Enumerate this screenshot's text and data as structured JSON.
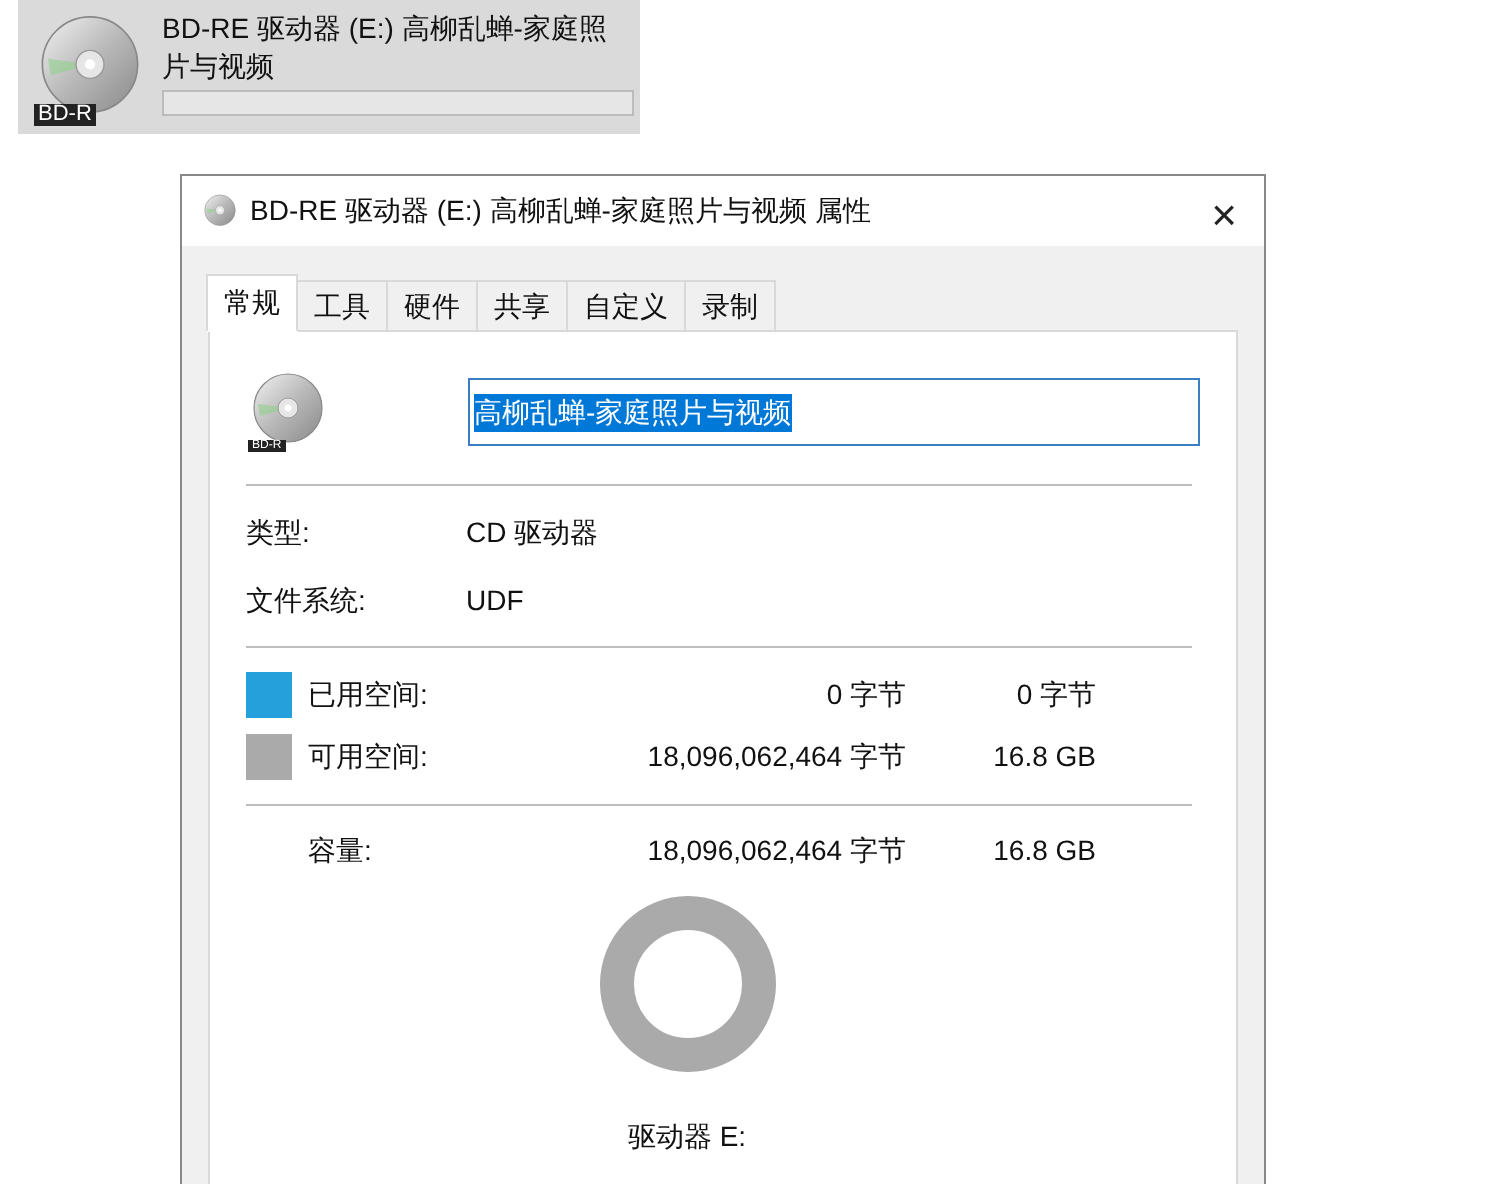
{
  "drive_tile": {
    "name": "BD-RE 驱动器 (E:) 高柳乱蝉-家庭照片与视频",
    "icon_label": "BD-R",
    "level": 0
  },
  "dialog": {
    "title": "BD-RE 驱动器 (E:) 高柳乱蝉-家庭照片与视频 属性",
    "close": "×"
  },
  "tabs": [
    {
      "label": "常规",
      "selected": true
    },
    {
      "label": "工具",
      "selected": false
    },
    {
      "label": "硬件",
      "selected": false
    },
    {
      "label": "共享",
      "selected": false
    },
    {
      "label": "自定义",
      "selected": false
    },
    {
      "label": "录制",
      "selected": false
    }
  ],
  "general": {
    "icon_label": "BD-R",
    "name_value": "高柳乱蝉-家庭照片与视频",
    "info": [
      {
        "label": "类型:",
        "value": "CD 驱动器"
      },
      {
        "label": "文件系统:",
        "value": "UDF"
      }
    ],
    "space": [
      {
        "label": "已用空间:",
        "bytes": "0 字节",
        "size": "0 字节",
        "color": "#26a0da"
      },
      {
        "label": "可用空间:",
        "bytes": "18,096,062,464 字节",
        "size": "16.8 GB",
        "color": "#aaaaaa"
      }
    ],
    "capacity": {
      "label": "容量:",
      "bytes": "18,096,062,464 字节",
      "size": "16.8 GB"
    },
    "drive_label": "驱动器 E:"
  }
}
